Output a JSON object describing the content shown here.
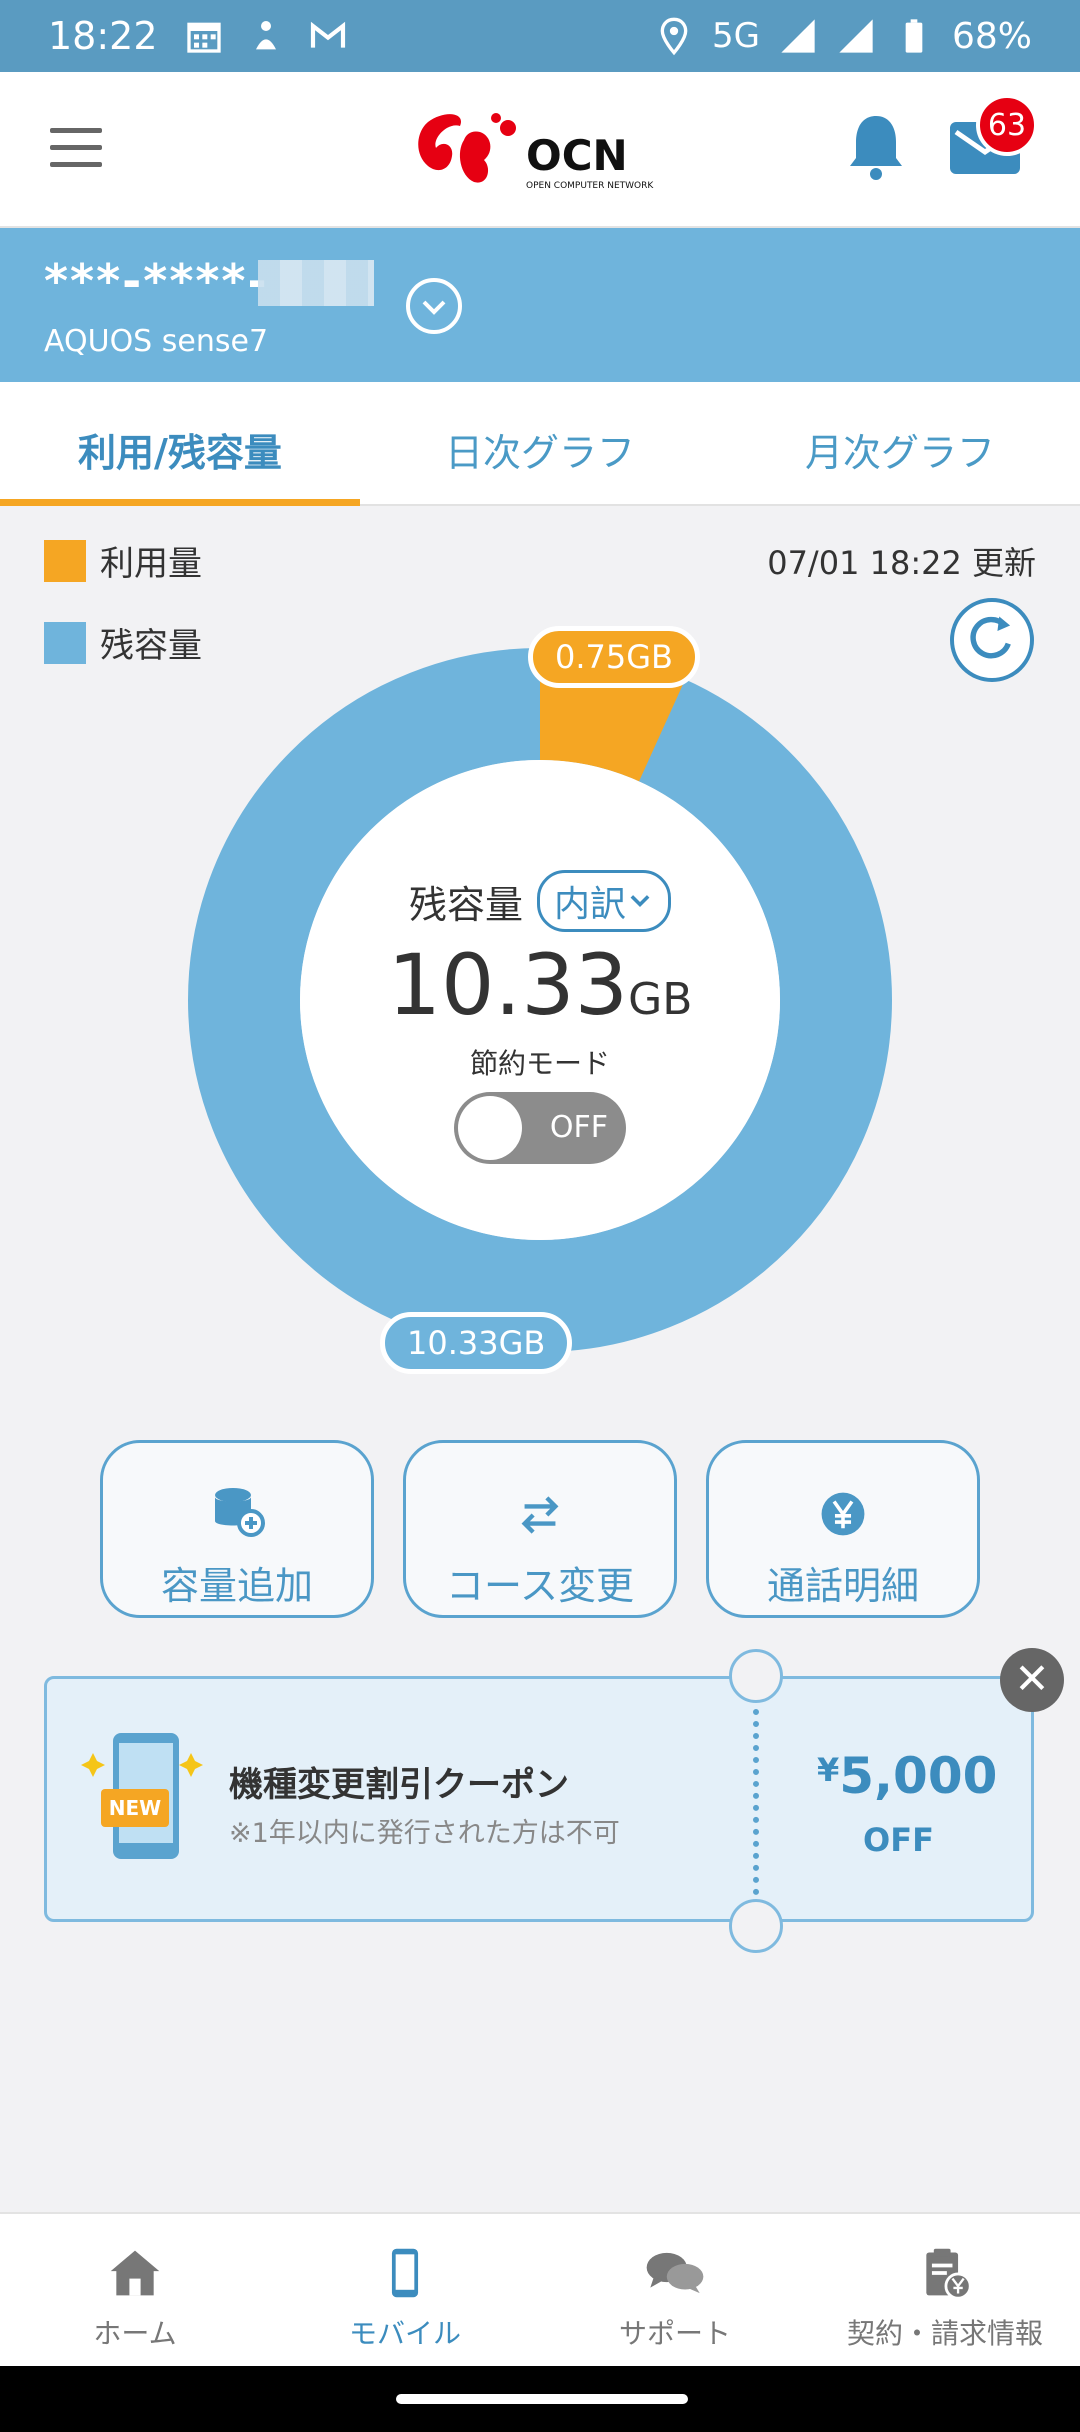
{
  "status_bar": {
    "time": "18:22",
    "network": "5G",
    "battery": "68%"
  },
  "header": {
    "logo_text": "OCN",
    "logo_sub": "OPEN COMPUTER NETWORK",
    "mail_badge": "63"
  },
  "account": {
    "number_masked": "***-****-",
    "device": "AQUOS sense7"
  },
  "tabs": [
    {
      "label": "利用/残容量",
      "active": true
    },
    {
      "label": "日次グラフ",
      "active": false
    },
    {
      "label": "月次グラフ",
      "active": false
    }
  ],
  "usage": {
    "legend_used": "利用量",
    "legend_remaining": "残容量",
    "updated": "07/01 18:22 更新",
    "used_label": "0.75GB",
    "remaining_label": "10.33GB",
    "used_gb": 0.75,
    "remaining_gb": 10.33,
    "center_title": "残容量",
    "breakdown_btn": "内訳",
    "center_value": "10.33",
    "center_unit": "GB",
    "save_mode_label": "節約モード",
    "toggle_state": "OFF",
    "colors": {
      "used": "#f5a623",
      "remaining": "#6fb4dc"
    }
  },
  "actions": [
    {
      "label": "容量追加",
      "icon": "data-add-icon"
    },
    {
      "label": "コース変更",
      "icon": "swap-arrows-icon"
    },
    {
      "label": "通話明細",
      "icon": "yen-coin-icon"
    }
  ],
  "coupon": {
    "badge": "NEW",
    "title": "機種変更割引クーポン",
    "note": "※1年以内に発行された方は不可",
    "yen": "¥",
    "amount": "5,000",
    "off": "OFF"
  },
  "bottom_nav": [
    {
      "label": "ホーム",
      "icon": "home-icon",
      "active": false
    },
    {
      "label": "モバイル",
      "icon": "mobile-icon",
      "active": true
    },
    {
      "label": "サポート",
      "icon": "chat-bubbles-icon",
      "active": false
    },
    {
      "label": "契約・請求情報",
      "icon": "contract-yen-icon",
      "active": false
    }
  ]
}
